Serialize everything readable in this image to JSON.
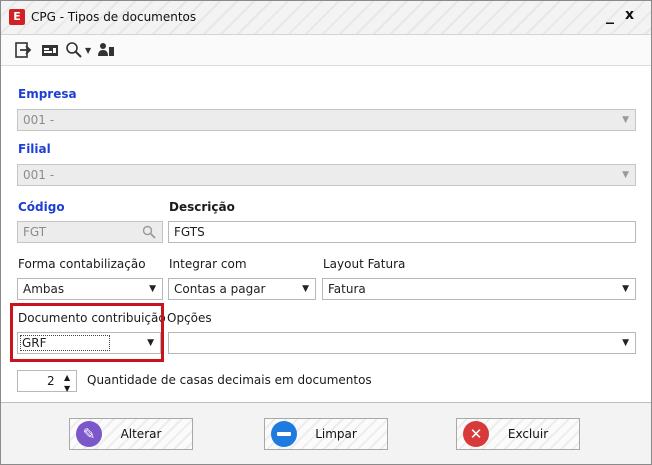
{
  "window": {
    "title": "CPG - Tipos de documentos",
    "minimize": "_",
    "close": "x",
    "app_icon_letter": "E"
  },
  "toolbar": {
    "icons": [
      "exit-icon",
      "card-icon",
      "search-icon",
      "dropdown-caret-icon",
      "users-icon"
    ]
  },
  "form": {
    "empresa": {
      "label": "Empresa",
      "value": "001 -"
    },
    "filial": {
      "label": "Filial",
      "value": "001 -"
    },
    "codigo": {
      "label": "Código",
      "value": "FGT"
    },
    "descricao": {
      "label": "Descrição",
      "value": "FGTS"
    },
    "forma_contabilizacao": {
      "label": "Forma contabilização",
      "value": "Ambas"
    },
    "integrar_com": {
      "label": "Integrar com",
      "value": "Contas a pagar"
    },
    "layout_fatura": {
      "label": "Layout Fatura",
      "value": "Fatura"
    },
    "documento_contribuicao": {
      "label": "Documento contribuição",
      "value": "GRF"
    },
    "opcoes": {
      "label": "Opções",
      "value": ""
    },
    "casas_decimais": {
      "value": "2",
      "label": "Quantidade de casas decimais em documentos"
    }
  },
  "buttons": {
    "alterar": {
      "label": "Alterar",
      "color": "#7b57c9"
    },
    "limpar": {
      "label": "Limpar",
      "color": "#1f7be0"
    },
    "excluir": {
      "label": "Excluir",
      "color": "#d83a3a"
    }
  },
  "colors": {
    "accent_label": "#1f3fd4",
    "highlight": "#c8141e"
  }
}
